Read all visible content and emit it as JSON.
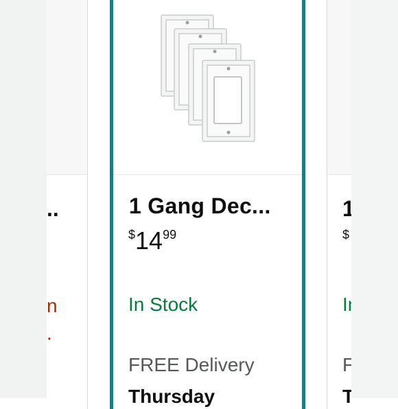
{
  "left_card": {
    "title_fragment": "..",
    "red_fragment_1": "n",
    "red_fragment_2": "."
  },
  "main_card": {
    "title": "1 Gang Dec...",
    "price": {
      "symbol": "$",
      "whole": "14",
      "fraction": "99"
    },
    "availability": "In Stock",
    "delivery_label": "FREE Delivery",
    "delivery_day": "Thursday"
  },
  "right_card": {
    "title_fragment": "1",
    "price_symbol": "$",
    "availability_fragment": "In",
    "delivery_fragment": "F",
    "day_fragment": "T"
  },
  "colors": {
    "selected_border": "#1e7b85",
    "in_stock": "#067d3e",
    "price_red": "#b12704"
  },
  "icons": {
    "product_image": "wall-plate-set-image"
  }
}
